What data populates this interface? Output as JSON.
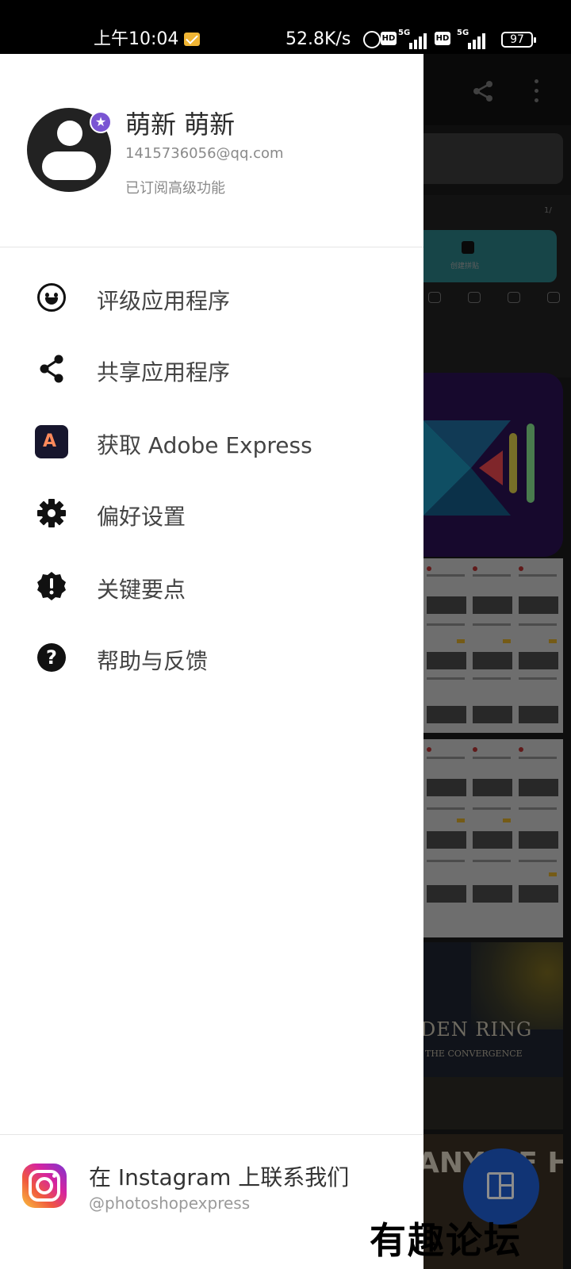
{
  "status_bar": {
    "time": "上午10:04",
    "network_speed": "52.8K/s",
    "sim1_tech": "5G",
    "sim2_tech": "5G",
    "hd_label": "HD",
    "battery": "97",
    "icons": [
      "mail-notification-icon",
      "alarm-icon",
      "hd-icon",
      "signal-icon",
      "battery-icon"
    ]
  },
  "drawer": {
    "profile": {
      "name": "萌新 萌新",
      "email": "1415736056@qq.com",
      "subscription": "已订阅高级功能",
      "badge_color": "#7a55d3"
    },
    "menu": [
      {
        "label": "评级应用程序",
        "icon": "smile-icon"
      },
      {
        "label": "共享应用程序",
        "icon": "share-icon"
      },
      {
        "label": "获取 Adobe Express",
        "icon": "adobe-express-icon"
      },
      {
        "label": "偏好设置",
        "icon": "gear-icon"
      },
      {
        "label": "关键要点",
        "icon": "alert-badge-icon"
      },
      {
        "label": "帮助与反馈",
        "icon": "help-icon"
      }
    ],
    "footer": {
      "title": "在 Instagram 上联系我们",
      "handle": "@photoshopexpress",
      "icon": "instagram-icon"
    }
  },
  "background_app": {
    "page_indicator": "1/",
    "create_label": "创建拼贴",
    "elden_title": "DEN RING",
    "elden_subtitle": "THE CONVERGENCE",
    "heroes_title": "ANY OF HEROES",
    "fab_icon": "layout-icon",
    "scrim_color": "rgba(0,0,0,0.45)"
  },
  "watermark": "有趣论坛"
}
